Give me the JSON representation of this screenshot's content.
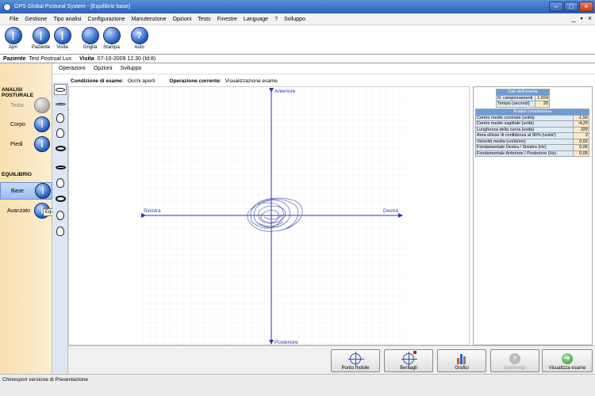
{
  "window": {
    "title": "GPS Global Postural System - [Equilibrio base]",
    "min": "–",
    "max": "□",
    "close": "×"
  },
  "menu": {
    "items": [
      "File",
      "Gestione",
      "Tipo analisi",
      "Configurazione",
      "Manutenzione",
      "Opzioni",
      "Tests",
      "Finestre",
      "Language",
      "?",
      "Sviluppo"
    ],
    "right_controls": [
      "_",
      "▪",
      "×"
    ]
  },
  "toolbar": {
    "buttons": [
      {
        "label": "Apri",
        "icon": "person-icon"
      },
      {
        "label": "Paziente",
        "icon": "person-icon"
      },
      {
        "label": "Visita",
        "icon": "person-icon"
      },
      {
        "label": "Griglia",
        "icon": "globe-icon"
      },
      {
        "label": "Stampa",
        "icon": "globe-icon"
      },
      {
        "label": "Auto",
        "icon": "help-icon"
      }
    ]
  },
  "patient": {
    "label_patient": "Paziente",
    "patient_name": "Test Postrual Lux",
    "label_visit": "Visita",
    "visit_value": "07-10-2009 12.30  (Id:8)"
  },
  "leftpanel": {
    "section1": "ANALISI POSTURALE",
    "items1": [
      "Testa",
      "Corpo",
      "Piedi"
    ],
    "section2": "EQUILIBRIO",
    "items2": [
      "Base",
      "Avanzato"
    ],
    "tooltip": "Equilibrio base"
  },
  "submenu": {
    "items": [
      "Operazioni",
      "Opzioni",
      "Sviluppo"
    ]
  },
  "cond": {
    "label_cond": "Condizione di esame:",
    "value_cond": "Occhi aperti",
    "label_op": "Operazione corrente:",
    "value_op": "Visualizzazione esame"
  },
  "plot": {
    "top": "Anteriore",
    "bottom": "Posteriore",
    "left": "Sinistra",
    "right": "Destra"
  },
  "exam": {
    "header": "Dati dell'esame",
    "rows": [
      {
        "label": "N. campionamenti",
        "value": "1.024"
      },
      {
        "label": "Tempo (secondi)",
        "value": "20"
      }
    ]
  },
  "analysis": {
    "header": "Analisi complessiva",
    "rows": [
      {
        "label": "Centro medio coronale (unità)",
        "value": "-1,56"
      },
      {
        "label": "Centro medio sagittale (unità)",
        "value": "-4,20"
      },
      {
        "label": "Lunghezza della curva (unità)",
        "value": "329"
      },
      {
        "label": "Area ellisse di confidenza al 90% (unità²)",
        "value": "2"
      },
      {
        "label": "Velocità media (unità/ms)",
        "value": "0,02"
      },
      {
        "label": "Fondamentale Destra / Sinistra (Hz)",
        "value": "0,06"
      },
      {
        "label": "Fondamentale Anteriore / Posteriore (Hz)",
        "value": "0,05"
      }
    ]
  },
  "buttons": [
    "Punto mobile",
    "Bersagli",
    "Grafici",
    "Interrompi",
    "Visualizza esame"
  ],
  "status": {
    "text": "Chinesport versione di Presentazione"
  }
}
